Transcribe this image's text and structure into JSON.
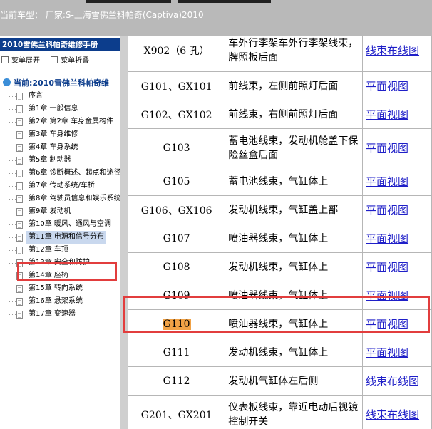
{
  "topbar": {
    "vehicle_label": "当前车型：",
    "manufacturer": "厂家:S-上海雪佛兰科帕奇(Captiva)2010"
  },
  "sidebar": {
    "manual_title": "2010雪佛兰科帕奇维修手册",
    "expand_label": "菜单展开",
    "collapse_label": "菜单折叠",
    "root_label": "当前:2010雪佛兰科帕奇维",
    "items": [
      {
        "label": "序言"
      },
      {
        "label": "第1章 一般信息"
      },
      {
        "label": "第2章 第2章 车身金属构件"
      },
      {
        "label": "第3章 车身维修"
      },
      {
        "label": "第4章 车身系统"
      },
      {
        "label": "第5章 制动器"
      },
      {
        "label": "第6章 诊断概述、起点和途径"
      },
      {
        "label": "第7章 传动系统/车桥"
      },
      {
        "label": "第8章 驾驶员信息和娱乐系统"
      },
      {
        "label": "第9章 发动机"
      },
      {
        "label": "第10章 暖风、通风与空调"
      },
      {
        "label": "第11章 电源和信号分布",
        "selected": true
      },
      {
        "label": "第12章 车顶"
      },
      {
        "label": "第13章 安全和防护"
      },
      {
        "label": "第14章 座椅"
      },
      {
        "label": "第15章 转向系统"
      },
      {
        "label": "第16章 悬架系统"
      },
      {
        "label": "第17章 变速器"
      }
    ]
  },
  "table": {
    "rows": [
      {
        "code": "X902（6 孔）",
        "desc": "车外行李架车外行李架线束，牌照板后面",
        "link": "线束布线图"
      },
      {
        "code": "G101、GX101",
        "desc": "前线束，左侧前照灯后面",
        "link": "平面视图"
      },
      {
        "code": "G102、GX102",
        "desc": "前线束，右侧前照灯后面",
        "link": "平面视图"
      },
      {
        "code": "G103",
        "desc": "蓄电池线束，发动机舱盖下保险丝盒后面",
        "link": "平面视图"
      },
      {
        "code": "G105",
        "desc": "蓄电池线束，气缸体上",
        "link": "平面视图"
      },
      {
        "code": "G106、GX106",
        "desc": "发动机线束，气缸盖上部",
        "link": "平面视图"
      },
      {
        "code": "G107",
        "desc": "喷油器线束，气缸体上",
        "link": "平面视图"
      },
      {
        "code": "G108",
        "desc": "发动机线束，气缸体上",
        "link": "平面视图"
      },
      {
        "code": "G109",
        "desc": "喷油器线束，气缸体上",
        "link": "平面视图"
      },
      {
        "code": "G110",
        "desc": "喷油器线束，气缸体上",
        "link": "平面视图",
        "highlight": true
      },
      {
        "code": "G111",
        "desc": "发动机线束，气缸体上",
        "link": "平面视图"
      },
      {
        "code": "G112",
        "desc": "发动机气缸体左后侧",
        "link": "线束布线图"
      },
      {
        "code": "G201、GX201",
        "desc": "仪表板线束，靠近电动后视镜控制开关",
        "link": "线束布线图"
      }
    ]
  },
  "colors": {
    "highlight_box": "#e23d3d",
    "search_hit": "#f1a246",
    "link": "#1f1fc8",
    "title_bar": "#0c3d8c"
  }
}
